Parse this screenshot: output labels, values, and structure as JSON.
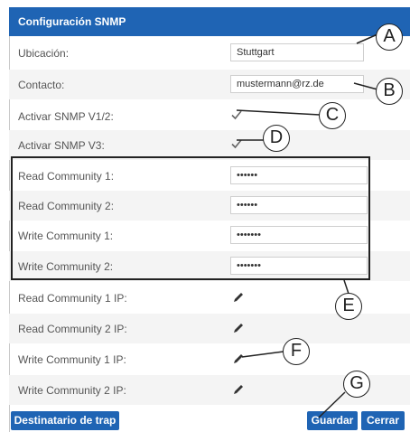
{
  "dialog": {
    "title": "Configuración SNMP"
  },
  "fields": {
    "ubicacion": {
      "label": "Ubicación:",
      "value": "Stuttgart"
    },
    "contacto": {
      "label": "Contacto:",
      "value": "mustermann@rz.de"
    },
    "snmp_v12": {
      "label": "Activar SNMP V1/2:",
      "checked": true
    },
    "snmp_v3": {
      "label": "Activar SNMP V3:",
      "checked": true
    },
    "read_community_1": {
      "label": "Read Community 1:",
      "value": "••••••"
    },
    "read_community_2": {
      "label": "Read Community 2:",
      "value": "••••••"
    },
    "write_community_1": {
      "label": "Write Community 1:",
      "value": "•••••••"
    },
    "write_community_2": {
      "label": "Write Community 2:",
      "value": "•••••••"
    },
    "read_community_1_ip": {
      "label": "Read Community 1 IP:"
    },
    "read_community_2_ip": {
      "label": "Read Community 2 IP:"
    },
    "write_community_1_ip": {
      "label": "Write Community 1 IP:"
    },
    "write_community_2_ip": {
      "label": "Write Community 2 IP:"
    }
  },
  "buttons": {
    "trap": "Destinatario de trap",
    "save": "Guardar",
    "close": "Cerrar"
  },
  "callouts": {
    "a": "A",
    "b": "B",
    "c": "C",
    "d": "D",
    "e": "E",
    "f": "F",
    "g": "G"
  },
  "icons": {
    "edit": "pencil-icon",
    "check": "checkmark-icon"
  },
  "colors": {
    "header": "#1f64b4",
    "button": "#1f64b4"
  }
}
